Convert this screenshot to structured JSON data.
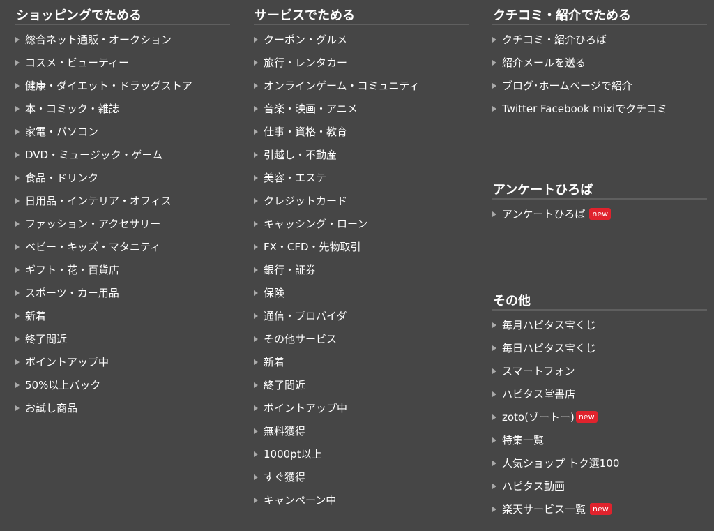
{
  "shopping": {
    "title": "ショッピングでためる",
    "items": [
      "総合ネット通販・オークション",
      "コスメ・ビューティー",
      "健康・ダイエット・ドラッグストア",
      "本・コミック・雑誌",
      "家電・パソコン",
      "DVD・ミュージック・ゲーム",
      "食品・ドリンク",
      "日用品・インテリア・オフィス",
      "ファッション・アクセサリー",
      "ベビー・キッズ・マタニティ",
      "ギフト・花・百貨店",
      "スポーツ・カー用品",
      "新着",
      "終了間近",
      "ポイントアップ中",
      "50%以上バック",
      "お試し商品"
    ]
  },
  "services": {
    "title": "サービスでためる",
    "items": [
      "クーポン・グルメ",
      "旅行・レンタカー",
      "オンラインゲーム・コミュニティ",
      "音楽・映画・アニメ",
      "仕事・資格・教育",
      "引越し・不動産",
      "美容・エステ",
      "クレジットカード",
      "キャッシング・ローン",
      "FX・CFD・先物取引",
      "銀行・証券",
      "保険",
      "通信・プロバイダ",
      "その他サービス",
      "新着",
      "終了間近",
      "ポイントアップ中",
      "無料獲得",
      "1000pt以上",
      "すぐ獲得",
      "キャンペーン中"
    ]
  },
  "referral": {
    "title": "クチコミ・紹介でためる",
    "items": [
      "クチコミ・紹介ひろば",
      "紹介メールを送る",
      "ブログ･ホームページで紹介",
      "Twitter Facebook mixiでクチコミ"
    ]
  },
  "survey": {
    "title": "アンケートひろば",
    "items": [
      "アンケートひろば"
    ]
  },
  "other": {
    "title": "その他",
    "items": [
      "毎月ハピタス宝くじ",
      "毎日ハピタス宝くじ",
      "スマートフォン",
      "ハピタス堂書店",
      "zoto(ゾートー)",
      "特集一覧",
      "人気ショップ トク選100",
      "ハピタス動画",
      "楽天サービス一覧"
    ]
  },
  "badge": {
    "new_label": "new",
    "color": "#e0232d"
  },
  "colors": {
    "background": "#464646",
    "text": "#ffffff",
    "divider": "#5f5f5f",
    "arrow": "#a9a9a9"
  }
}
